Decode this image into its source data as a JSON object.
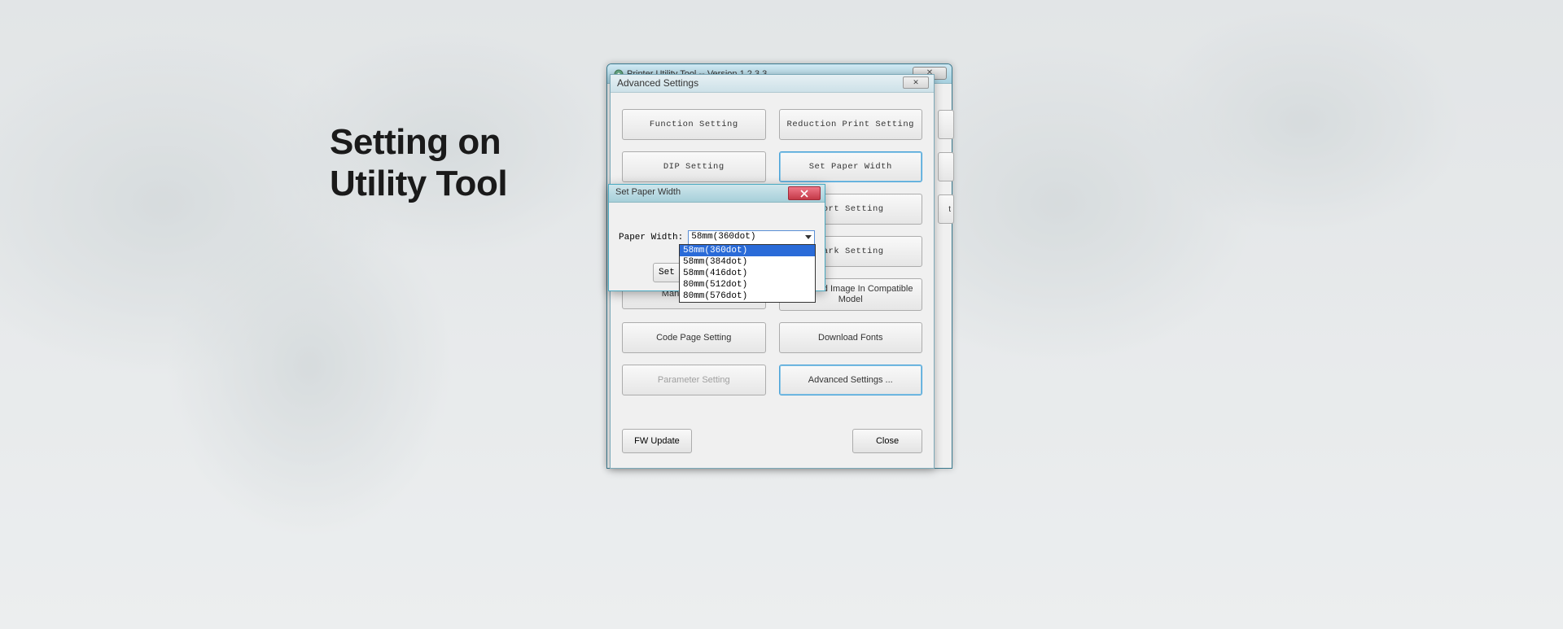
{
  "headline": {
    "line1": "Setting on",
    "line2": "Utility Tool"
  },
  "mainWindow": {
    "title": "Printer Utility Tool -- Version 1.2.3.3"
  },
  "advanced": {
    "title": "Advanced Settings",
    "close_glyph": "✕",
    "buttons": {
      "function_setting": "Function Setting",
      "reduction_print": "Reduction Print Setting",
      "dip_setting": "DIP Setting",
      "set_paper_width": "Set Paper Width",
      "port_setting_visible": "Port Setting",
      "mark_setting_visible": "Mark Setting",
      "manage_images": "Manage Images",
      "download_image_compat": "Download Image In Compatible Model",
      "code_page_setting": "Code Page Setting",
      "download_fonts": "Download Fonts",
      "parameter_setting": "Parameter Setting",
      "advanced_settings": "Advanced Settings ..."
    },
    "footer": {
      "fw_update": "FW Update",
      "close": "Close"
    },
    "peek_right": "t"
  },
  "setPaperWidth": {
    "title": "Set Paper Width",
    "label": "Paper Width:",
    "selected": "58mm(360dot)",
    "set_button_visible": "Set",
    "options": [
      "58mm(360dot)",
      "58mm(384dot)",
      "58mm(416dot)",
      "80mm(512dot)",
      "80mm(576dot)"
    ]
  }
}
